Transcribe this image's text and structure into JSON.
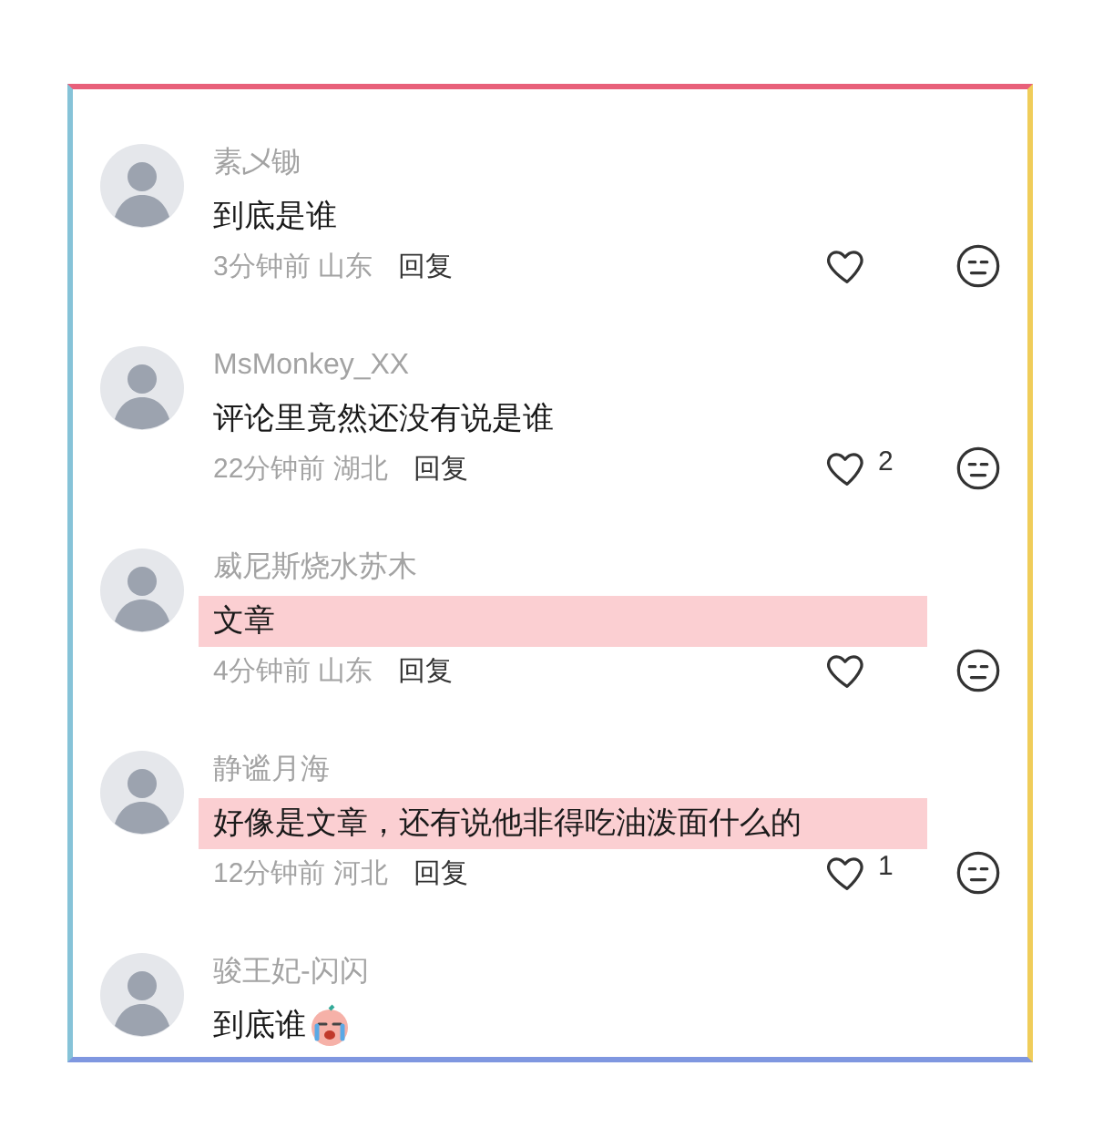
{
  "comments": [
    {
      "kind": "text",
      "user": "素乄锄",
      "text": "到底是谁",
      "time": "3分钟前",
      "region": "山东",
      "reply": "回复",
      "highlighted": false
    },
    {
      "kind": "text",
      "user": "MsMonkey_XX",
      "text": "评论里竟然还没有说是谁",
      "time": "22分钟前",
      "region": "湖北",
      "reply": "回复",
      "likes": "2",
      "highlighted": false
    },
    {
      "kind": "text",
      "user": "威尼斯烧水苏木",
      "text": "文章",
      "time": "4分钟前",
      "region": "山东",
      "reply": "回复",
      "highlighted": true
    },
    {
      "kind": "text",
      "user": "静谧月海",
      "text": "好像是文章，还有说他非得吃油泼面什么的",
      "time": "12分钟前",
      "region": "河北",
      "reply": "回复",
      "likes": "1",
      "highlighted": true
    },
    {
      "kind": "text_with_emoji",
      "user": "骏王妃-闪闪",
      "text": "到底谁",
      "highlighted": false
    }
  ]
}
